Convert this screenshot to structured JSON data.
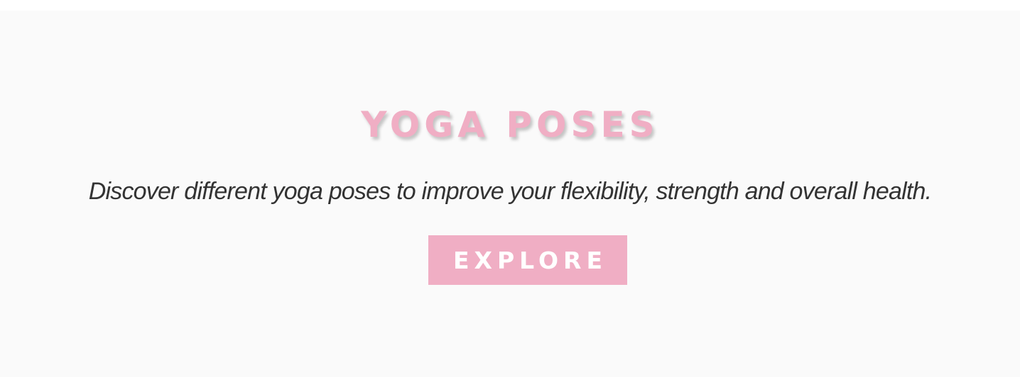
{
  "hero": {
    "title": "YOGA POSES",
    "subtitle": "Discover different yoga poses to improve your flexibility, strength and overall health.",
    "button_label": "EXPLORE"
  },
  "colors": {
    "accent": "#f0aec4",
    "text": "#333333",
    "background": "#fafafa"
  }
}
